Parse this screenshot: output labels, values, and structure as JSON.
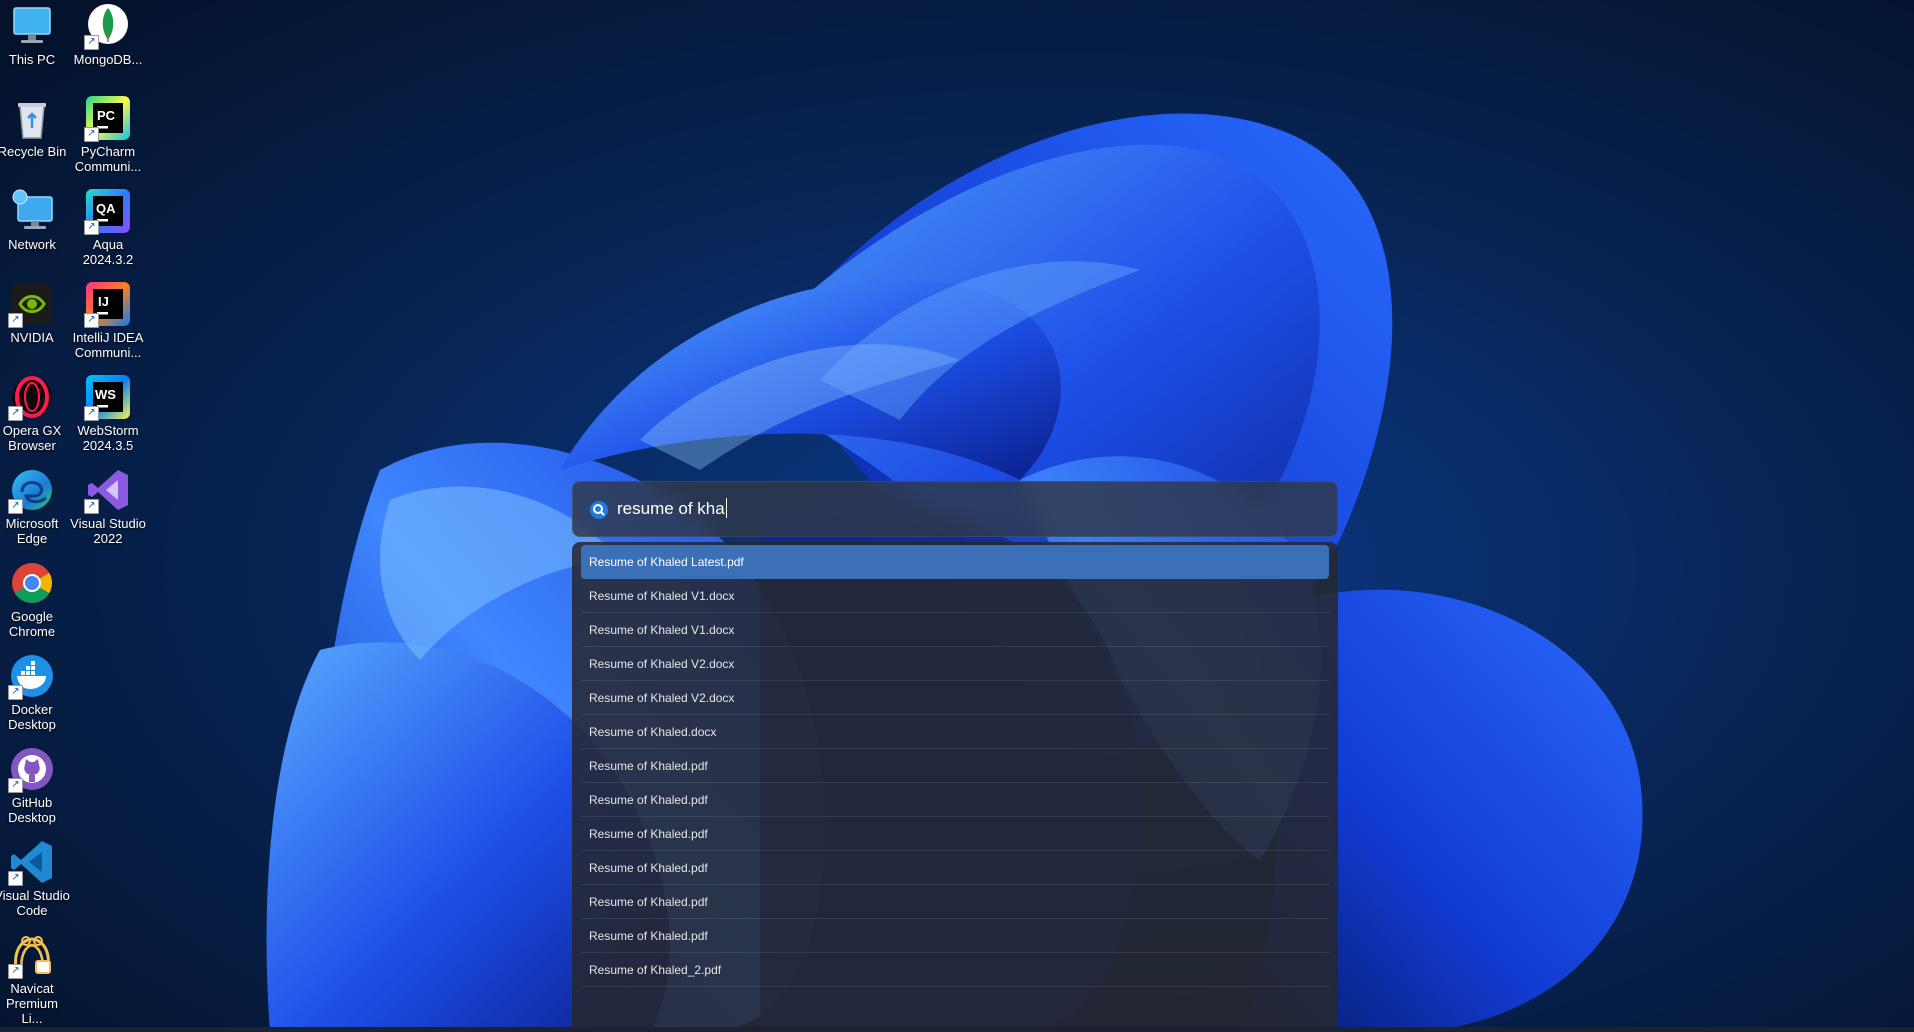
{
  "desktop": {
    "icons": [
      {
        "label": "This PC",
        "icon": "monitor-icon"
      },
      {
        "label": "MongoDB...",
        "icon": "mongodb-leaf-icon"
      },
      {
        "label": "Recycle Bin",
        "icon": "recycle-bin-icon"
      },
      {
        "label": "PyCharm\nCommuni...",
        "icon": "pycharm-icon"
      },
      {
        "label": "Network",
        "icon": "network-icon"
      },
      {
        "label": "Aqua\n2024.3.2",
        "icon": "aqua-icon"
      },
      {
        "label": "NVIDIA",
        "icon": "nvidia-icon"
      },
      {
        "label": "IntelliJ IDEA\nCommuni...",
        "icon": "intellij-icon"
      },
      {
        "label": "Opera GX\nBrowser",
        "icon": "opera-gx-icon"
      },
      {
        "label": "WebStorm\n2024.3.5",
        "icon": "webstorm-icon"
      },
      {
        "label": "Microsoft\nEdge",
        "icon": "edge-icon"
      },
      {
        "label": "Visual Studio\n2022",
        "icon": "visual-studio-icon"
      },
      {
        "label": "Google\nChrome",
        "icon": "chrome-icon"
      },
      {
        "label": "Docker\nDesktop",
        "icon": "docker-icon"
      },
      {
        "label": "GitHub\nDesktop",
        "icon": "github-icon"
      },
      {
        "label": "Visual Studio\nCode",
        "icon": "vscode-icon"
      },
      {
        "label": "Navicat\nPremium Li...",
        "icon": "navicat-icon"
      }
    ]
  },
  "search": {
    "query": "resume of kha",
    "icon": "search-icon"
  },
  "results": {
    "items": [
      {
        "label": "Resume of Khaled  Latest.pdf",
        "selected": true
      },
      {
        "label": "Resume of Khaled V1.docx"
      },
      {
        "label": "Resume of Khaled V1.docx"
      },
      {
        "label": "Resume of Khaled V2.docx"
      },
      {
        "label": "Resume of Khaled V2.docx"
      },
      {
        "label": "Resume of Khaled.docx"
      },
      {
        "label": "Resume of Khaled.pdf"
      },
      {
        "label": "Resume of Khaled.pdf"
      },
      {
        "label": "Resume of Khaled.pdf"
      },
      {
        "label": "Resume of Khaled.pdf"
      },
      {
        "label": "Resume of Khaled.pdf"
      },
      {
        "label": "Resume of Khaled.pdf"
      },
      {
        "label": "Resume of Khaled_2.pdf"
      }
    ]
  },
  "colors": {
    "wallpaper_bg": "#061a3c",
    "bloom_blue": "#1f5cff",
    "selection": "#3b6fb6"
  }
}
